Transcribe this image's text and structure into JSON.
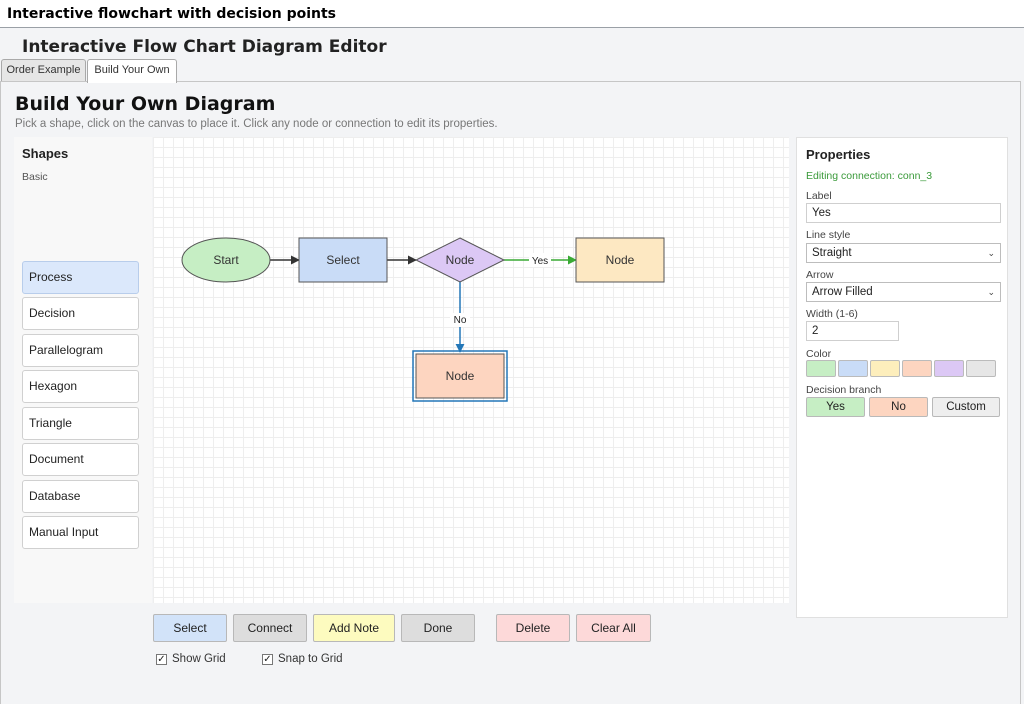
{
  "window": {
    "title": "Interactive flowchart with decision points"
  },
  "app": {
    "title": "Interactive Flow Chart Diagram Editor"
  },
  "tabs": [
    {
      "label": "Order Example",
      "active": false
    },
    {
      "label": "Build Your Own",
      "active": true
    }
  ],
  "page": {
    "title": "Build Your Own Diagram",
    "subtitle": "Pick a shape, click on the canvas to place it. Click any node or connection to edit its properties."
  },
  "shapes": {
    "heading": "Shapes",
    "group": "Basic",
    "items": [
      {
        "label": "Process",
        "selected": true
      },
      {
        "label": "Decision",
        "selected": false
      },
      {
        "label": "Parallelogram",
        "selected": false
      },
      {
        "label": "Hexagon",
        "selected": false
      },
      {
        "label": "Triangle",
        "selected": false
      },
      {
        "label": "Document",
        "selected": false
      },
      {
        "label": "Database",
        "selected": false
      },
      {
        "label": "Manual Input",
        "selected": false
      }
    ]
  },
  "diagram": {
    "nodes": [
      {
        "label": "Start",
        "shape": "ellipse",
        "fill": "#c6eec4"
      },
      {
        "label": "Select",
        "shape": "process",
        "fill": "#c9dcf7"
      },
      {
        "label": "Node",
        "shape": "decision",
        "fill": "#dcc8f5"
      },
      {
        "label": "Node",
        "shape": "process",
        "fill": "#fde8c2"
      },
      {
        "label": "Node",
        "shape": "process",
        "fill": "#fdd5c0",
        "selected": true
      }
    ],
    "connections": [
      {
        "label": "",
        "color": "#333333"
      },
      {
        "label": "",
        "color": "#333333"
      },
      {
        "label": "Yes",
        "color": "#3aaa35"
      },
      {
        "label": "No",
        "color": "#2377b8"
      }
    ]
  },
  "properties": {
    "heading": "Properties",
    "editing": "Editing connection: conn_3",
    "label_label": "Label",
    "label_value": "Yes",
    "line_style_label": "Line style",
    "line_style_value": "Straight",
    "arrow_label": "Arrow",
    "arrow_value": "Arrow Filled",
    "width_label": "Width (1-6)",
    "width_value": "2",
    "color_label": "Color",
    "colors": [
      "#c6eec4",
      "#c9dcf7",
      "#fdeebc",
      "#fdd5c0",
      "#dcc8f5",
      "#e6e6e6"
    ],
    "branch_label": "Decision branch",
    "branch_buttons": [
      {
        "label": "Yes",
        "color": "#c6eec4"
      },
      {
        "label": "No",
        "color": "#fdd5c0"
      },
      {
        "label": "Custom",
        "color": "#eeeeee"
      }
    ]
  },
  "toolbar": {
    "buttons": [
      {
        "label": "Select",
        "color": "#d2e3f9"
      },
      {
        "label": "Connect",
        "color": "#dddddd"
      },
      {
        "label": "Add Note",
        "color": "#fdfbbf"
      },
      {
        "label": "Done",
        "color": "#dddddd"
      },
      {
        "label": "Delete",
        "color": "#fdd9d9"
      },
      {
        "label": "Clear All",
        "color": "#fdd9d9"
      }
    ],
    "show_grid_label": "Show Grid",
    "show_grid_checked": true,
    "snap_label": "Snap to Grid",
    "snap_checked": true
  },
  "icons": {
    "select_chevron": "chevron-down-icon",
    "checkbox": "checkmark-icon"
  }
}
